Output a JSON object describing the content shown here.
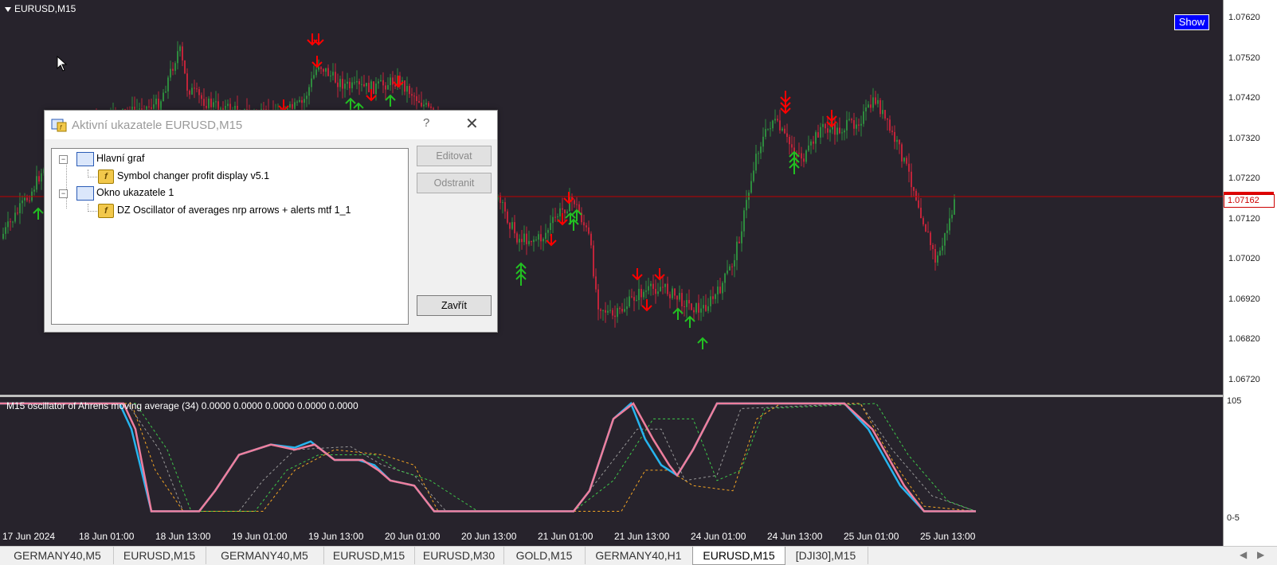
{
  "chart": {
    "symbol_label": "EURUSD,M15",
    "show_button": "Show",
    "current_price": "1.07162",
    "price_ticks": [
      "1.07620",
      "1.07520",
      "1.07420",
      "1.07320",
      "1.07220",
      "1.07120",
      "1.07020",
      "1.06920",
      "1.06820",
      "1.06720"
    ],
    "time_ticks": [
      "17 Jun 2024",
      "18 Jun 01:00",
      "18 Jun 13:00",
      "19 Jun 01:00",
      "19 Jun 13:00",
      "20 Jun 01:00",
      "20 Jun 13:00",
      "21 Jun 01:00",
      "21 Jun 13:00",
      "24 Jun 01:00",
      "24 Jun 13:00",
      "25 Jun 01:00",
      "25 Jun 13:00"
    ],
    "colors": {
      "background": "#27232c",
      "bull": "#2e8b3e",
      "bear": "#c0243a",
      "arrow_up": "#22c022",
      "arrow_down": "#ff0000",
      "price_line": "#c00000"
    }
  },
  "subwindow": {
    "label": "M15 oscillator of Ahrens moving average (34) 0.0000 0.0000 0.0000 0.0000 0.0000",
    "tick_top": "105",
    "tick_bottom": "-5",
    "tick_bottom2": "0",
    "colors": {
      "main": "#27b4ee",
      "signal": "#ee7e9d",
      "slow1": "#f5a623",
      "slow2": "#3ec94a",
      "slow3": "#999999"
    }
  },
  "dialog": {
    "title": "Aktivní ukazatele EURUSD,M15",
    "help": "?",
    "close": "✕",
    "tree": [
      {
        "label": "Hlavní graf",
        "children": [
          "Symbol changer profit display v5.1"
        ]
      },
      {
        "label": "Okno ukazatele 1",
        "children": [
          "DZ Oscillator of averages nrp arrows + alerts mtf 1_1"
        ]
      }
    ],
    "buttons": {
      "edit": "Editovat",
      "delete": "Odstranit",
      "close": "Zavřít"
    }
  },
  "tabs": [
    "GERMANY40,M5",
    "EURUSD,M15",
    "GERMANY40,M5",
    "EURUSD,M15",
    "EURUSD,M30",
    "GOLD,M15",
    "GERMANY40,H1",
    "EURUSD,M15",
    "[DJI30],M15"
  ],
  "active_tab": 7,
  "tab_scroll": {
    "left": "◀",
    "right": "▶"
  }
}
